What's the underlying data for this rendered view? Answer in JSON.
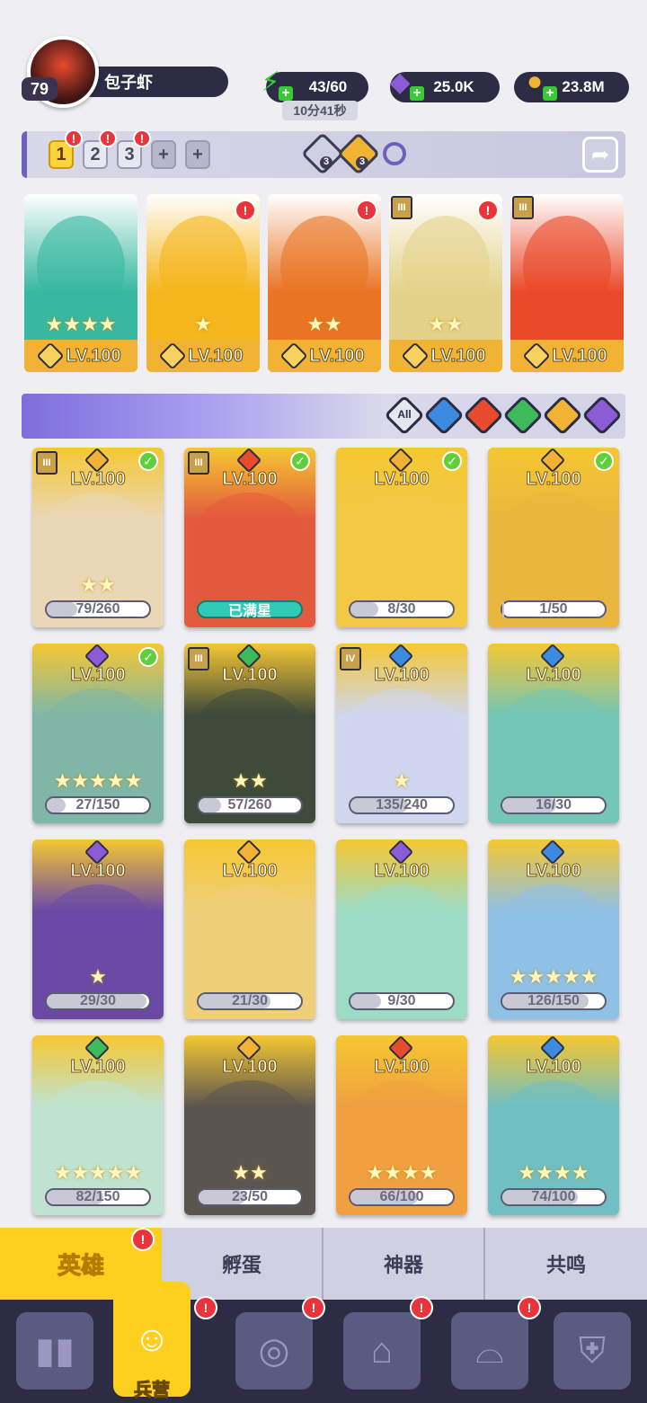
{
  "player": {
    "name": "包子虾",
    "level": "79"
  },
  "resources": {
    "energy": {
      "value": "43/60",
      "timer": "10分41秒"
    },
    "gems": {
      "value": "25.0K"
    },
    "coins": {
      "value": "23.8M"
    }
  },
  "team_tabs": [
    {
      "label": "1",
      "active": true,
      "alert": "!"
    },
    {
      "label": "2",
      "active": false,
      "alert": "!"
    },
    {
      "label": "3",
      "active": false,
      "alert": "!"
    },
    {
      "label": "+"
    },
    {
      "label": "+"
    }
  ],
  "team_counters": {
    "axe": "3",
    "gold": "3"
  },
  "team_cards": [
    {
      "level": "LV.100",
      "color": "#38b8a0",
      "stars": "★★★★"
    },
    {
      "level": "LV.100",
      "color": "#f5b51c",
      "stars": "★",
      "alert": "!"
    },
    {
      "level": "LV.100",
      "color": "#e97424",
      "stars": "★★",
      "alert": "!"
    },
    {
      "level": "LV.100",
      "color": "#e4d28a",
      "stars": "★★",
      "alert": "!",
      "rank": "III"
    },
    {
      "level": "LV.100",
      "color": "#ea4a2a",
      "stars": "",
      "rank": "III"
    }
  ],
  "filters": [
    "All",
    "water",
    "fire",
    "wind",
    "light",
    "dark"
  ],
  "filter_all_label": "All",
  "heroes": [
    {
      "level": "LV.100",
      "progress": "79/260",
      "pct": 0.3,
      "bg": "#e9d7b6",
      "elem": "#f2b233",
      "rank": "III",
      "check": true,
      "stars": "★★"
    },
    {
      "level": "LV.100",
      "progress": "已满星",
      "pct": 1,
      "bg": "#e35a3d",
      "elem": "#e84b2e",
      "rank": "III",
      "check": true,
      "full": true,
      "stars": ""
    },
    {
      "level": "LV.100",
      "progress": "8/30",
      "pct": 0.27,
      "bg": "#f2c945",
      "elem": "#f2b233",
      "check": true,
      "stars": ""
    },
    {
      "level": "LV.100",
      "progress": "1/50",
      "pct": 0.02,
      "bg": "#e9b73d",
      "elem": "#f2b233",
      "check": true,
      "stars": ""
    },
    {
      "level": "LV.100",
      "progress": "27/150",
      "pct": 0.18,
      "bg": "#7fb7a6",
      "elem": "#8b5cd6",
      "check": true,
      "stars": "★★★★★"
    },
    {
      "level": "LV.100",
      "progress": "57/260",
      "pct": 0.22,
      "bg": "#3e4a3b",
      "elem": "#3fba5a",
      "rank": "III",
      "stars": "★★"
    },
    {
      "level": "LV.100",
      "progress": "135/240",
      "pct": 0.56,
      "bg": "#cfd6ee",
      "elem": "#3d8be0",
      "rank": "IV",
      "stars": "★"
    },
    {
      "level": "LV.100",
      "progress": "16/30",
      "pct": 0.53,
      "bg": "#74c6b6",
      "elem": "#3d8be0",
      "stars": ""
    },
    {
      "level": "LV.100",
      "progress": "29/30",
      "pct": 0.97,
      "bg": "#6b4aa5",
      "elem": "#8b5cd6",
      "stars": "★"
    },
    {
      "level": "LV.100",
      "progress": "21/30",
      "pct": 0.7,
      "bg": "#f0cf7a",
      "elem": "#f2b233",
      "stars": ""
    },
    {
      "level": "LV.100",
      "progress": "9/30",
      "pct": 0.3,
      "bg": "#9cdcc6",
      "elem": "#8b5cd6",
      "stars": ""
    },
    {
      "level": "LV.100",
      "progress": "126/150",
      "pct": 0.84,
      "bg": "#8fc0e6",
      "elem": "#3d8be0",
      "stars": "★★★★★"
    },
    {
      "level": "LV.100",
      "progress": "82/150",
      "pct": 0.55,
      "bg": "#bfe3d0",
      "elem": "#3fba5a",
      "stars": "★★★★★"
    },
    {
      "level": "LV.100",
      "progress": "23/50",
      "pct": 0.46,
      "bg": "#5b5550",
      "elem": "#f2b233",
      "stars": "★★"
    },
    {
      "level": "LV.100",
      "progress": "66/100",
      "pct": 0.66,
      "bg": "#f0a040",
      "elem": "#e84b2e",
      "stars": "★★★★"
    },
    {
      "level": "LV.100",
      "progress": "74/100",
      "pct": 0.74,
      "bg": "#6fbfc3",
      "elem": "#3d8be0",
      "stars": "★★★★"
    }
  ],
  "bottom_tabs": [
    {
      "label": "英雄",
      "active": true,
      "alert": "!"
    },
    {
      "label": "孵蛋"
    },
    {
      "label": "神器"
    },
    {
      "label": "共鸣"
    }
  ],
  "nav": [
    {
      "icon": "cards-icon",
      "label": ""
    },
    {
      "icon": "barracks-icon",
      "label": "兵营",
      "active": true,
      "alert": "!"
    },
    {
      "icon": "map-icon",
      "label": "",
      "alert": "!"
    },
    {
      "icon": "castle-icon",
      "label": "",
      "alert": "!"
    },
    {
      "icon": "mushroom-icon",
      "label": "",
      "alert": "!"
    },
    {
      "icon": "guild-icon",
      "label": ""
    }
  ]
}
